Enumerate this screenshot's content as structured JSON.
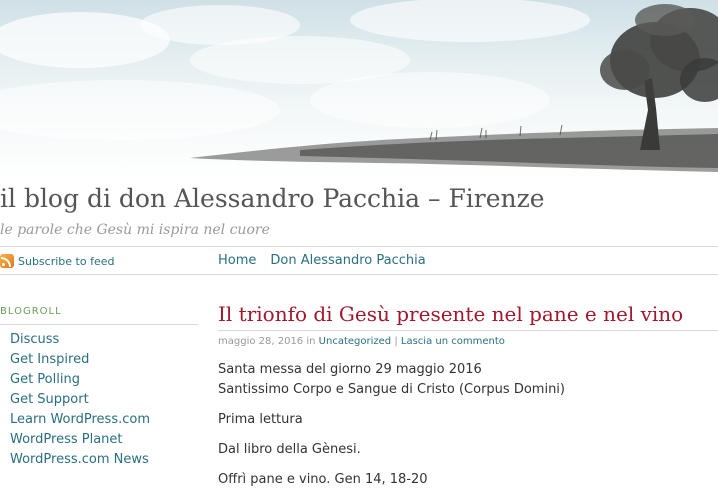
{
  "header": {
    "site_title": "il blog di don Alessandro Pacchia – Firenze",
    "tagline": "le parole che Gesù mi ispira nel cuore"
  },
  "feed": {
    "label": "Subscribe to feed",
    "icon": "rss-icon"
  },
  "nav": {
    "items": [
      "Home",
      "Don Alessandro Pacchia"
    ]
  },
  "sidebar": {
    "heading": "BLOGROLL",
    "links": [
      "Discuss",
      "Get Inspired",
      "Get Polling",
      "Get Support",
      "Learn WordPress.com",
      "WordPress Planet",
      "WordPress.com News"
    ]
  },
  "post": {
    "title": "Il trionfo di Gesù presente nel pane e nel vino",
    "date": "maggio 28, 2016",
    "in": "in",
    "category": "Uncategorized",
    "separator": "|",
    "comment_link": "Lascia un commento",
    "lines": [
      "Santa messa del giorno 29 maggio 2016",
      "Santissimo Corpo e Sangue di Cristo (Corpus Domini)",
      "Prima lettura",
      "Dal libro della Gènesi.",
      "Offrì pane e vino. Gen 14, 18-20"
    ]
  },
  "colors": {
    "link": "#2a6f80",
    "post_title": "#a2182a",
    "sidebar_heading": "#6c9d56"
  }
}
